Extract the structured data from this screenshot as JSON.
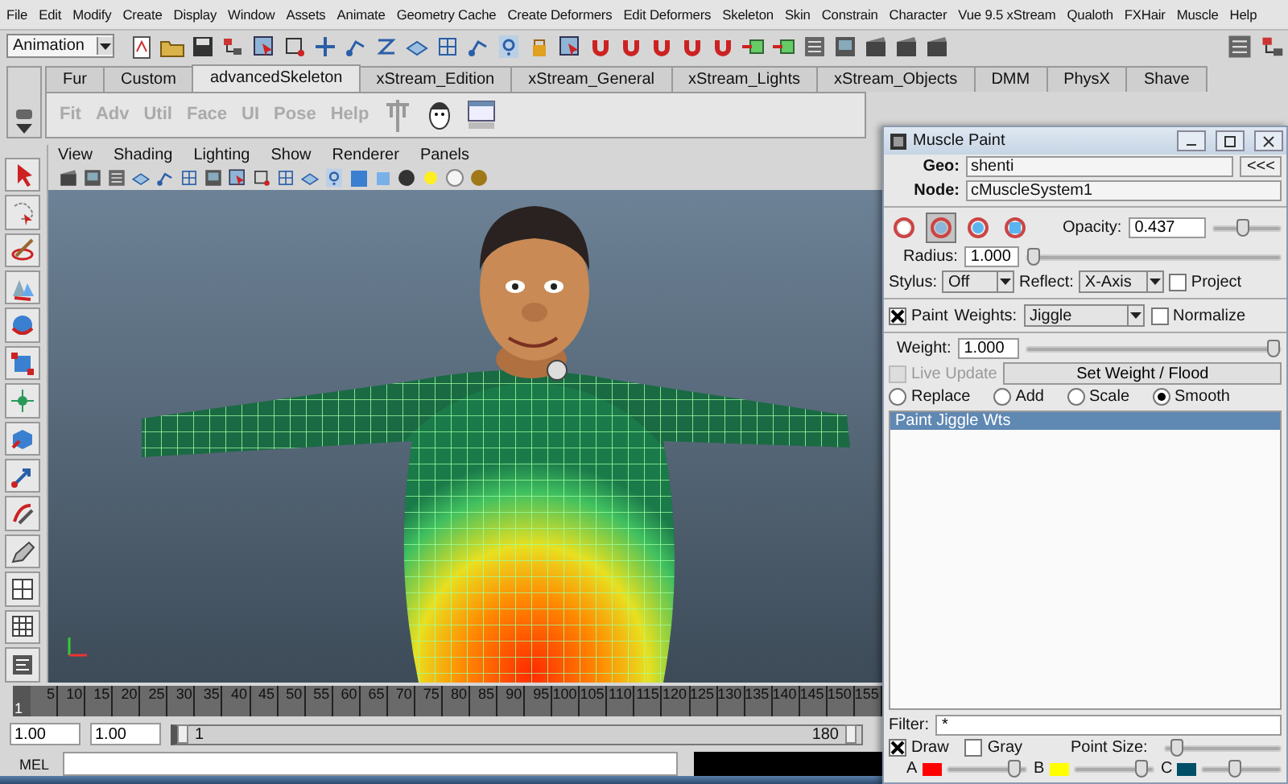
{
  "menu_bar": {
    "items": [
      "File",
      "Edit",
      "Modify",
      "Create",
      "Display",
      "Window",
      "Assets",
      "Animate",
      "Geometry Cache",
      "Create Deformers",
      "Edit Deformers",
      "Skeleton",
      "Skin",
      "Constrain",
      "Character",
      "Vue 9.5 xStream",
      "Qualoth",
      "FXHair",
      "Muscle",
      "Help"
    ]
  },
  "status_line": {
    "menu_set": "Animation"
  },
  "shelf": {
    "tabs": [
      {
        "label": "Fur",
        "selected": false
      },
      {
        "label": "Custom",
        "selected": false
      },
      {
        "label": "advancedSkeleton",
        "selected": true
      },
      {
        "label": "xStream_Edition",
        "selected": false
      },
      {
        "label": "xStream_General",
        "selected": false
      },
      {
        "label": "xStream_Lights",
        "selected": false
      },
      {
        "label": "xStream_Objects",
        "selected": false
      },
      {
        "label": "DMM",
        "selected": false
      },
      {
        "label": "PhysX",
        "selected": false
      },
      {
        "label": "Shave",
        "selected": false
      }
    ],
    "buttons": [
      "Fit",
      "Adv",
      "Util",
      "Face",
      "UI",
      "Pose",
      "Help"
    ]
  },
  "viewport": {
    "menus": [
      "View",
      "Shading",
      "Lighting",
      "Show",
      "Renderer",
      "Panels"
    ]
  },
  "time_slider": {
    "current_frame": "1",
    "ticks": [
      "5",
      "10",
      "15",
      "20",
      "25",
      "30",
      "35",
      "40",
      "45",
      "50",
      "55",
      "60",
      "65",
      "70",
      "75",
      "80",
      "85",
      "90",
      "95",
      "100",
      "105",
      "110",
      "115",
      "120",
      "125",
      "130",
      "135",
      "140",
      "145",
      "150",
      "155"
    ]
  },
  "range_slider": {
    "start_time": "1.00",
    "playback_start": "1.00",
    "range_start": "1",
    "range_end": "180",
    "level": 1
  },
  "command_line": {
    "language": "MEL"
  },
  "muscle_paint": {
    "title": "Muscle Paint",
    "geo": {
      "label": "Geo:",
      "value": "shenti",
      "button": "<<<"
    },
    "node": {
      "label": "Node:",
      "value": "cMuscleSystem1"
    },
    "brushes": [
      {
        "selected": false
      },
      {
        "selected": true
      },
      {
        "selected": false
      },
      {
        "selected": false
      }
    ],
    "opacity": {
      "label": "Opacity:",
      "value": "0.437",
      "level": 0.437
    },
    "radius": {
      "label": "Radius:",
      "value": "1.000",
      "level": 0
    },
    "stylus": {
      "label": "Stylus:",
      "value": "Off"
    },
    "reflect": {
      "label": "Reflect:",
      "value": "X-Axis"
    },
    "project": {
      "label": "Project",
      "checked": false
    },
    "paint": {
      "label": "Paint",
      "checked": true
    },
    "weights": {
      "label": "Weights:",
      "value": "Jiggle"
    },
    "normalize": {
      "label": "Normalize",
      "checked": false
    },
    "weight": {
      "label": "Weight:",
      "value": "1.000",
      "level": 1
    },
    "live_update": {
      "label": "Live Update",
      "checked": false,
      "disabled": true
    },
    "flood_button": "Set Weight / Flood",
    "modes": [
      {
        "label": "Replace",
        "selected": false
      },
      {
        "label": "Add",
        "selected": false
      },
      {
        "label": "Scale",
        "selected": false
      },
      {
        "label": "Smooth",
        "selected": true
      }
    ],
    "weight_list": [
      {
        "label": "Paint Jiggle Wts",
        "selected": true
      }
    ],
    "filter": {
      "label": "Filter:",
      "value": "*"
    },
    "draw": {
      "label": "Draw",
      "checked": true
    },
    "gray": {
      "label": "Gray",
      "checked": false
    },
    "point_size": {
      "label": "Point Size:",
      "level": 0.05
    },
    "colors": [
      {
        "label": "A",
        "color": "#ff0000",
        "level": 0.92
      },
      {
        "label": "B",
        "color": "#ffff00",
        "level": 0.93
      },
      {
        "label": "C",
        "color": "#004f66",
        "level": 0.4
      }
    ]
  }
}
